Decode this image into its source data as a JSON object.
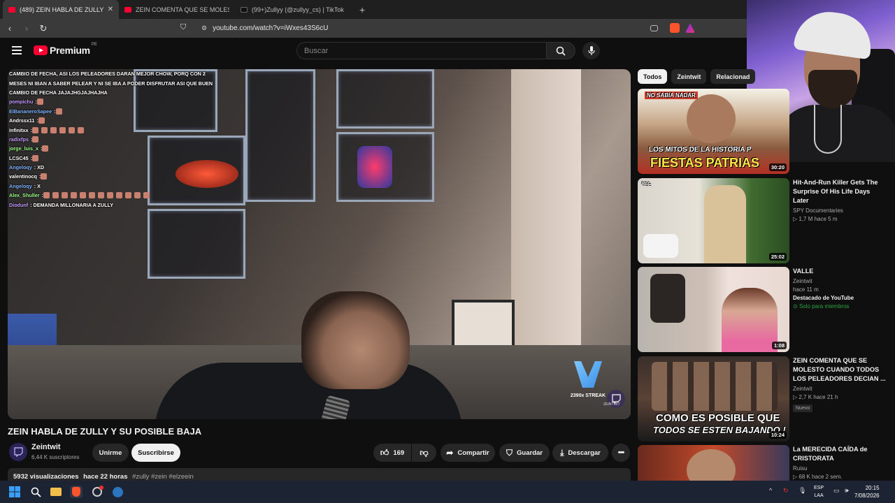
{
  "browser": {
    "tabs": [
      {
        "title": "(489) ZEIN HABLA DE ZULLY Y SU",
        "active": true
      },
      {
        "title": "ZEIN COMENTA QUE SE MOLESTO C",
        "active": false
      },
      {
        "title": "(99+)Zullyy (@zullyy_cs) | TikTok",
        "active": false
      }
    ],
    "new_tab": "+",
    "close": "✕",
    "url": "youtube.com/watch?v=iWxes43S6cU"
  },
  "youtube": {
    "logo": "Premium",
    "country": "PE",
    "search_placeholder": "Buscar"
  },
  "chat": [
    {
      "user": "",
      "text": "CAMBIO DE FECHA, ASI LOS PELEADORES DARAN MEJOR CHOW, PORQ CON 2",
      "color": "#ffffff"
    },
    {
      "user": "",
      "text": "MESES NI IBAN A SABER PELEAR Y NI SE IBA A PODER DISFRUTAR ASI QUE BUEN",
      "color": "#ffffff"
    },
    {
      "user": "",
      "text": "CAMBIO DE FECHA  JAJAJHGJAJHAJHA",
      "color": "#ffffff"
    },
    {
      "user": "pompichu",
      "text": ":",
      "color": "#c69bff",
      "emotes": 1
    },
    {
      "user": "ElBananeroSapee",
      "text": ":",
      "color": "#7fb5ff",
      "emotes": 1
    },
    {
      "user": "Andrssx11",
      "text": ":",
      "color": "#ffffff",
      "emotes": 1
    },
    {
      "user": "Infinitxx",
      "text": ":",
      "color": "#ffffff",
      "emotes": 6
    },
    {
      "user": "radixfps",
      "text": ":",
      "color": "#c69bff",
      "emotes": 1
    },
    {
      "user": "jorge_luis_x",
      "text": ":",
      "color": "#9cff8a",
      "emotes": 1
    },
    {
      "user": "LCSC45",
      "text": ":",
      "color": "#ffffff",
      "emotes": 1
    },
    {
      "user": "Angeloqy",
      "text": ": XD",
      "color": "#7fb5ff",
      "emotes": 0
    },
    {
      "user": "valentinocq",
      "text": ":",
      "color": "#ffffff",
      "emotes": 1
    },
    {
      "user": "Angeloqy",
      "text": ": X",
      "color": "#7fb5ff",
      "emotes": 0
    },
    {
      "user": "Alex_Shuller",
      "text": ":",
      "color": "#9cff8a",
      "emotes": 12
    },
    {
      "user": "Diodunf",
      "text": ": DEMANDA MILLONARIA A ZULLY",
      "color": "#c69bff",
      "emotes": 0
    }
  ],
  "player": {
    "streak": "2390x STREAK",
    "watermark": "ZEINTWIT"
  },
  "video": {
    "title": "ZEIN HABLA DE ZULLY Y SU POSIBLE BAJA",
    "channel": "Zeintwit",
    "subscribers": "6,44 K suscriptores",
    "join": "Unirme",
    "subscribe": "Suscribirse",
    "likes": "169",
    "share": "Compartir",
    "save": "Guardar",
    "download": "Descargar",
    "views": "5932 visualizaciones",
    "age": "hace 22 horas",
    "tags": "#zully #zein #elzeein"
  },
  "sidebar": {
    "chips": [
      "Todos",
      "Zeintwit",
      "Relacionad"
    ],
    "items": [
      {
        "title": "",
        "channel": "",
        "meta": "",
        "duration": "30:20",
        "overlay": "FIESTAS PATRIAS",
        "overlay2": "LOS MITOS DE LA HISTORIA P",
        "tag": "NO SABIA NADAR"
      },
      {
        "title": "Hit-And-Run Killer Gets The Surprise Of His Life Days Later",
        "channel": "SPY Documentaries",
        "meta": "1,7 M  hace 5 m",
        "duration": "25:02",
        "rec": "REC"
      },
      {
        "title": "VALLE",
        "channel": "Zeintwit",
        "meta": "hace 11 m",
        "featured": "Destacado de YouTube",
        "members": "Solo para miembros",
        "duration": "1:08"
      },
      {
        "title": "ZEIN COMENTA QUE SE MOLESTO CUANDO TODOS LOS PELEADORES DECIAN ...",
        "channel": "Zeintwit",
        "meta": "2,7 K  hace 21 h",
        "badge": "Nuevo",
        "duration": "10:24",
        "overlay": "COMO ES POSIBLE QUE",
        "overlay2": "TODOS SE ESTEN BAJANDO !"
      },
      {
        "title": "La MERECIDA CAÍDA de CRISTORATA",
        "channel": "Ruisu",
        "meta": "68 K  hace 2 sem."
      }
    ]
  },
  "taskbar": {
    "lang": "ESP",
    "lang2": "LAA",
    "time": "20:15",
    "date": "7/08/2026"
  },
  "colors": {
    "accent": "#ff0033",
    "bg": "#0f0f0f",
    "surface": "#272727",
    "members": "#2ba640"
  }
}
